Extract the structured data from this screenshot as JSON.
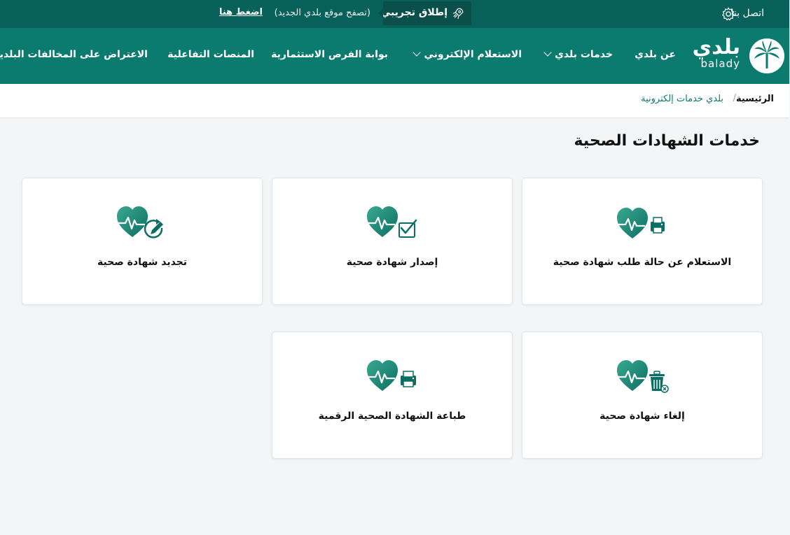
{
  "topbar": {
    "contact_label": "اتصل بنا",
    "beta_label": "إطلاق تجريبي",
    "beta_note": "(تصفح موقع بلدي الجديد)",
    "beta_link": "اضغط هنا"
  },
  "logo": {
    "arabic": "بلدي",
    "english": "balady"
  },
  "nav": {
    "items": [
      {
        "label": "عن بلدي"
      },
      {
        "label": "خدمات بلدي"
      },
      {
        "label": "الاستعلام الإلكتروني"
      },
      {
        "label": "بوابة الفرص الاستثمارية"
      },
      {
        "label": "المنصات التفاعلية"
      },
      {
        "label": "الاعتراض على المخالفات البلدية"
      }
    ]
  },
  "breadcrumb": {
    "home": "الرئيسية",
    "separator": "/",
    "current": "بلدي خدمات إلكترونية"
  },
  "page_title": "خدمات الشهادات الصحية",
  "cards": [
    {
      "label": "الاستعلام عن حالة طلب شهادة صحية",
      "icon": "heart-printer-icon"
    },
    {
      "label": "إصدار شهادة صحية",
      "icon": "heart-check-icon"
    },
    {
      "label": "تجديد شهادة صحية",
      "icon": "heart-edit-icon"
    },
    {
      "label": "إلغاء شهادة صحية",
      "icon": "heart-trash-icon"
    },
    {
      "label": "طباعة الشهادة الصحية الرقمية",
      "icon": "heart-printer-icon"
    }
  ],
  "colors": {
    "topbar": "#07605a",
    "nav": "#0b7a6f",
    "heart_dark": "#0b6e64",
    "heart_light": "#2e9c86"
  }
}
